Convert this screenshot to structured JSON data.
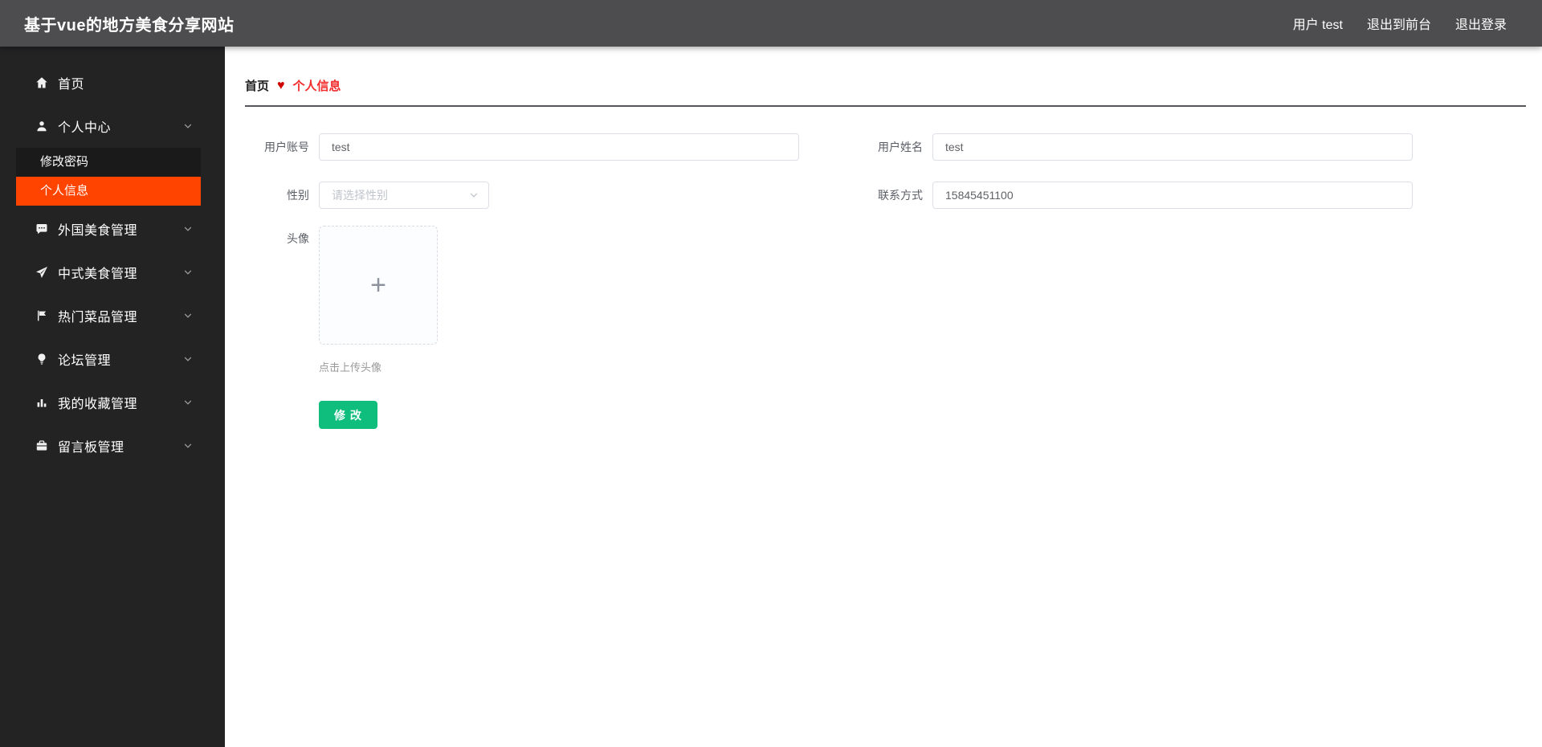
{
  "topbar": {
    "title": "基于vue的地方美食分享网站",
    "user": "用户 test",
    "exit_front": "退出到前台",
    "logout": "退出登录"
  },
  "sidebar": {
    "items": [
      {
        "label": "首页",
        "icon": "home-icon"
      },
      {
        "label": "个人中心",
        "icon": "user-icon",
        "expanded": true,
        "children": [
          {
            "label": "修改密码",
            "active": false
          },
          {
            "label": "个人信息",
            "active": true
          }
        ]
      },
      {
        "label": "外国美食管理",
        "icon": "chat-icon"
      },
      {
        "label": "中式美食管理",
        "icon": "send-icon"
      },
      {
        "label": "热门菜品管理",
        "icon": "flag-icon"
      },
      {
        "label": "论坛管理",
        "icon": "bulb-icon"
      },
      {
        "label": "我的收藏管理",
        "icon": "bar-chart-icon"
      },
      {
        "label": "留言板管理",
        "icon": "briefcase-icon"
      }
    ]
  },
  "breadcrumb": {
    "home": "首页",
    "current": "个人信息"
  },
  "icons": {
    "heart": "♥",
    "plus": "+"
  },
  "form": {
    "account": {
      "label": "用户账号",
      "value": "test"
    },
    "name": {
      "label": "用户姓名",
      "value": "test"
    },
    "gender": {
      "label": "性别",
      "placeholder": "请选择性别"
    },
    "phone": {
      "label": "联系方式",
      "value": "15845451100"
    },
    "avatar": {
      "label": "头像",
      "tip": "点击上传头像"
    },
    "submit_label": "修 改"
  },
  "colors": {
    "accent_orange": "#ff4400",
    "success_green": "#0fbe7d",
    "breadcrumb_red": "#f22b2b",
    "topbar_gray": "#4d4d4f",
    "sidebar_dark": "#232324"
  }
}
